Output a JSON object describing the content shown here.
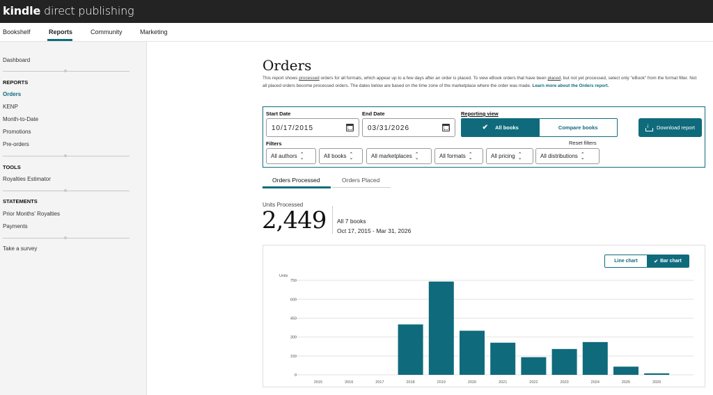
{
  "header": {
    "logo_bold": "kindle",
    "logo_light": "direct publishing"
  },
  "nav": {
    "items": [
      "Bookshelf",
      "Reports",
      "Community",
      "Marketing"
    ],
    "active": "Reports"
  },
  "sidebar": {
    "dashboard": "Dashboard",
    "reports_head": "REPORTS",
    "reports": [
      "Orders",
      "KENP",
      "Month-to-Date",
      "Promotions",
      "Pre-orders"
    ],
    "tools_head": "TOOLS",
    "tools": [
      "Royalties Estimator"
    ],
    "statements_head": "STATEMENTS",
    "statements": [
      "Prior Months' Royalties",
      "Payments"
    ],
    "survey": "Take a survey"
  },
  "page": {
    "title": "Orders",
    "desc_1": "This report shows ",
    "desc_processed": "processed",
    "desc_2": " orders for all formats, which appear up to a few days after an order is placed. To view eBook orders that have been ",
    "desc_placed": "placed",
    "desc_3": ", but not yet processed, select only \"eBook\" from the format filter. Not all placed orders become processed orders. The dates below are based on the time zone of the marketplace where the order was made. ",
    "desc_link": "Learn more about the Orders report."
  },
  "filters": {
    "start_label": "Start Date",
    "start_value": "10/17/2015",
    "end_label": "End Date",
    "end_value": "03/31/2026",
    "view_label": "Reporting view",
    "view_all": "All books",
    "view_compare": "Compare books",
    "download": "Download report",
    "filters_label": "Filters",
    "reset": "Reset filters",
    "selects": [
      "All authors",
      "All books",
      "All marketplaces",
      "All formats",
      "All pricing",
      "All distributions"
    ]
  },
  "tabs": [
    "Orders Processed",
    "Orders Placed"
  ],
  "summary": {
    "units_label": "Units Processed",
    "units_value": "2,449",
    "books": "All 7 books",
    "range": "Oct 17, 2015 - Mar 31, 2026"
  },
  "chart_toggle": {
    "line": "Line chart",
    "bar": "Bar chart"
  },
  "colors": {
    "accent": "#0f6b7c"
  },
  "chart_data": {
    "type": "bar",
    "ylabel": "Units",
    "yticks": [
      0,
      150,
      300,
      450,
      600,
      750
    ],
    "ylim": [
      0,
      800
    ],
    "categories": [
      "2015",
      "2016",
      "2017",
      "2018",
      "2019",
      "2020",
      "2021",
      "2022",
      "2023",
      "2024",
      "2025",
      "2026"
    ],
    "values": [
      0,
      0,
      0,
      400,
      740,
      350,
      255,
      140,
      205,
      260,
      65,
      12
    ],
    "grid": true
  }
}
